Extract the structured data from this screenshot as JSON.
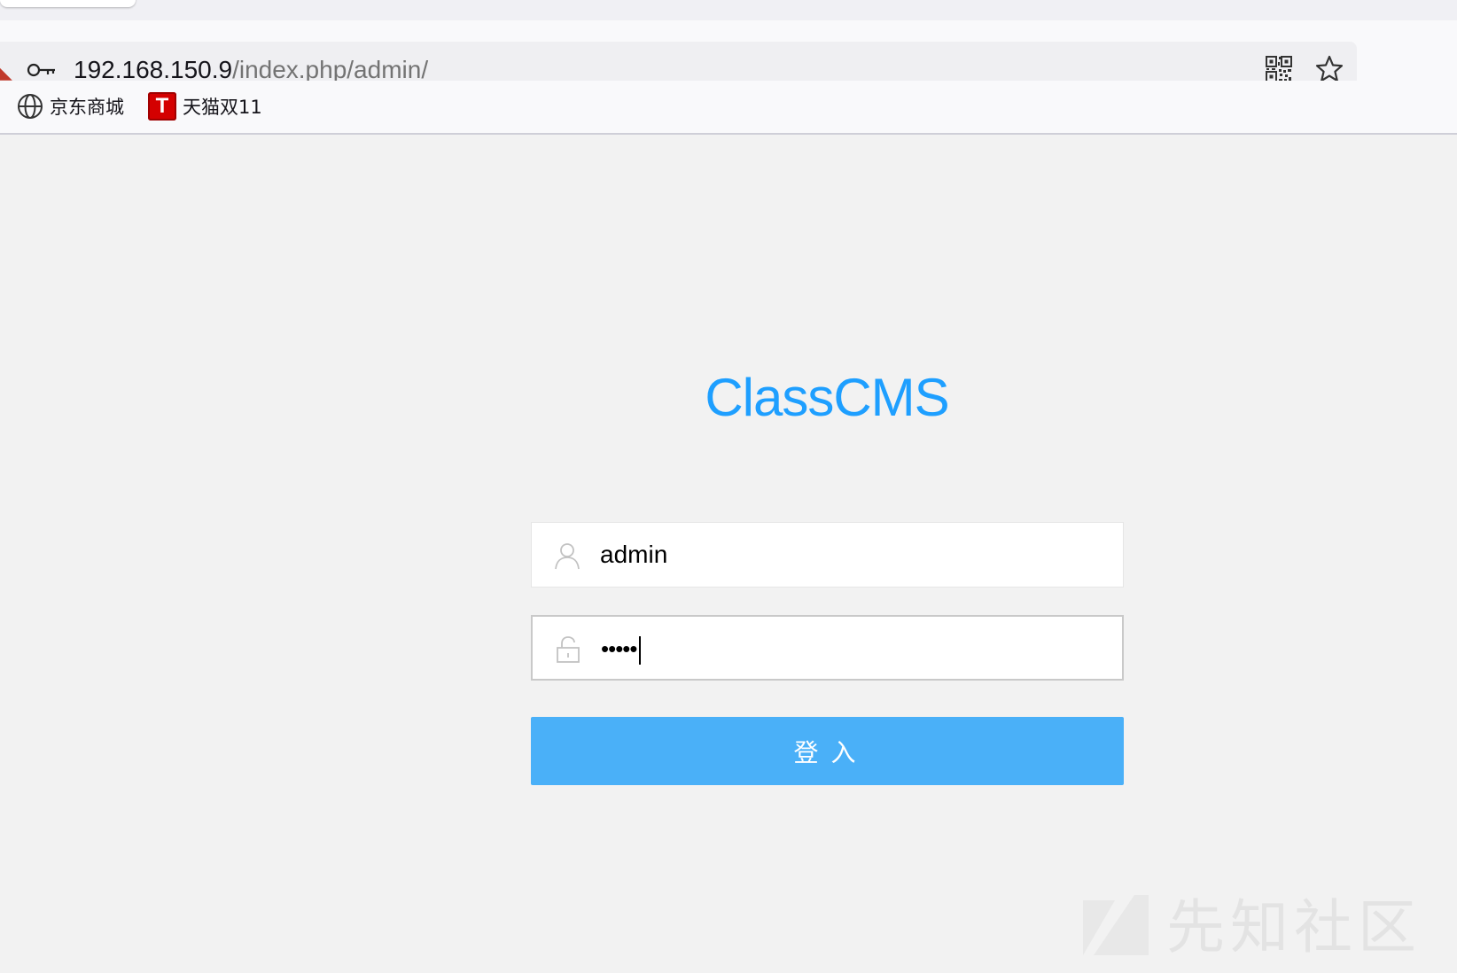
{
  "browser": {
    "url_host": "192.168.150.9",
    "url_path": "/index.php/admin/",
    "bookmarks": [
      {
        "label": "京东商城",
        "icon": "globe-icon"
      },
      {
        "label": "天猫双11",
        "icon": "tmall-icon",
        "icon_letter": "T"
      }
    ]
  },
  "login": {
    "title": "ClassCMS",
    "username_value": "admin",
    "password_value": "•••••",
    "submit_label": "登入",
    "accent_color": "#1e9fff",
    "button_color": "#4ab0f8"
  },
  "watermark": {
    "text": "先知社区"
  }
}
